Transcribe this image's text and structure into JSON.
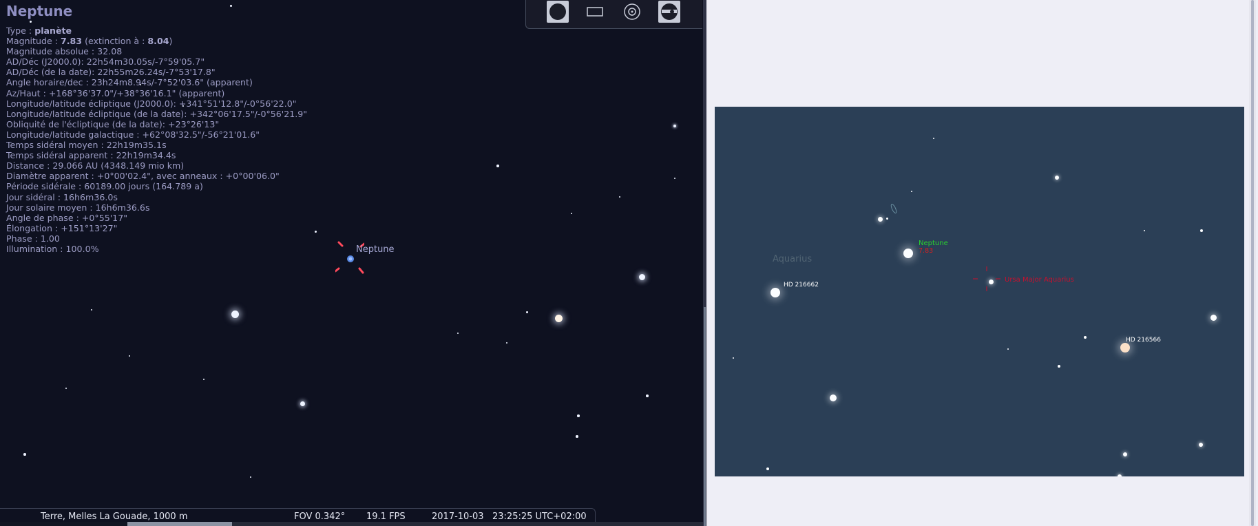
{
  "object_info": {
    "name": "Neptune",
    "type_label": "Type : ",
    "type_value": "planète",
    "magnitude_label": "Magnitude : ",
    "magnitude_value": "7.83",
    "extinction_label": " (extinction à : ",
    "extinction_value": "8.04",
    "close_paren": ")",
    "lines": [
      "Magnitude absolue : 32.08",
      "AD/Déc (J2000.0): 22h54m30.05s/-7°59'05.7\"",
      "AD/Déc (de la date): 22h55m26.24s/-7°53'17.8\"",
      "Angle horaire/dec : 23h24m8.94s/-7°52'03.6\" (apparent)",
      "Az/Haut : +168°36'37.0\"/+38°36'16.1\" (apparent)",
      "Longitude/latitude écliptique (J2000.0): +341°51'12.8\"/-0°56'22.0\"",
      "Longitude/latitude écliptique (de la date): +342°06'17.5\"/-0°56'21.9\"",
      "Obliquité de l'écliptique (de la date): +23°26'13\"",
      "Longitude/latitude galactique : +62°08'32.5\"/-56°21'01.6\"",
      "Temps sidéral moyen : 22h19m35.1s",
      "Temps sidéral apparent : 22h19m34.4s",
      "Distance : 29.066 AU (4348.149 mio km)",
      "Diamètre apparent : +0°00'02.4\", avec anneaux : +0°00'06.0\"",
      "Période sidérale : 60189.00 jours (164.789 a)",
      "Jour sidéral : 16h6m36.0s",
      "Jour solaire moyen : 16h6m36.6s",
      "Angle de phase : +0°55'17\"",
      "Élongation : +151°13'27\"",
      "Phase : 1.00",
      "Illumination : 100.0%"
    ]
  },
  "sky_view": {
    "target_label": "Neptune"
  },
  "toolbar": {
    "icons": [
      "filled-circle-icon",
      "rectangle-icon",
      "concentric-circle-icon",
      "telescope-icon"
    ]
  },
  "status_bar": {
    "location": "Terre, Melles La Gouade, 1000 m",
    "fov": "FOV 0.342°",
    "fps": "19.1 FPS",
    "date": "2017-10-03",
    "time": "23:25:25 UTC+02:00"
  },
  "finder_chart": {
    "constellation": "Aquarius",
    "planet_name": "Neptune",
    "planet_mag": "7.83",
    "star_label_1": "HD 216662",
    "star_label_2": "HD 216566",
    "marker_text": "Ursa Major Aquarius"
  },
  "colors": {
    "sky_background": "#0e1120",
    "chart_background": "#2b3f56",
    "neptune_label": "#29d12f",
    "marker": "#c8102e"
  }
}
